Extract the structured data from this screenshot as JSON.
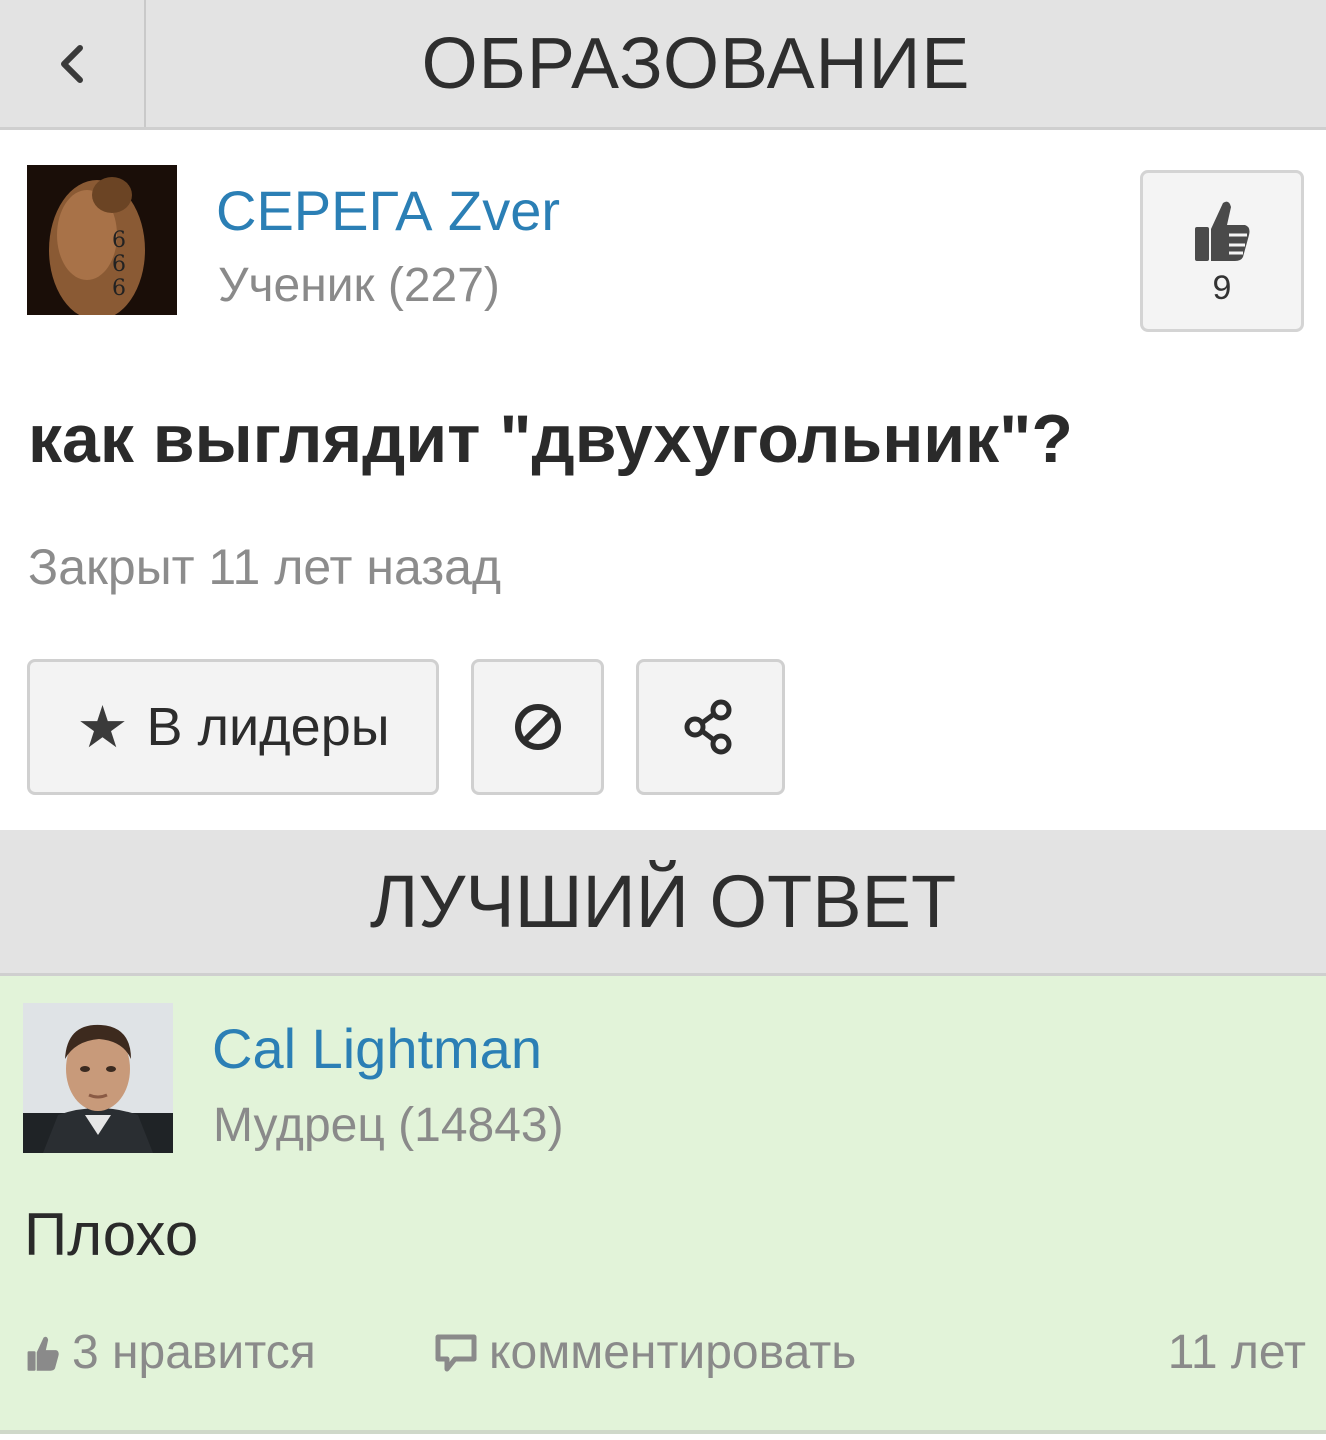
{
  "header": {
    "title": "ОБРАЗОВАНИЕ",
    "back_icon": "chevron-left-icon"
  },
  "question": {
    "author": {
      "name": "СЕРЕГА Zver",
      "rank": "Ученик (227)"
    },
    "likes": "9",
    "title": "как выглядит \"двухугольник\"?",
    "status": "Закрыт 11 лет назад",
    "actions": {
      "leaders_label": "В лидеры",
      "star_icon": "★",
      "block_icon": "block-icon",
      "share_icon": "share-icon"
    }
  },
  "best_answer": {
    "section_title": "ЛУЧШИЙ ОТВЕТ",
    "author": {
      "name": "Cal Lightman",
      "rank": "Мудрец (14843)"
    },
    "text": "Плохо",
    "likes_label": "3 нравится",
    "comment_label": "комментировать",
    "time": "11 лет"
  },
  "colors": {
    "link": "#2b7fb5",
    "header_bg": "#e3e3e3",
    "answer_bg": "#e2f3d9"
  }
}
